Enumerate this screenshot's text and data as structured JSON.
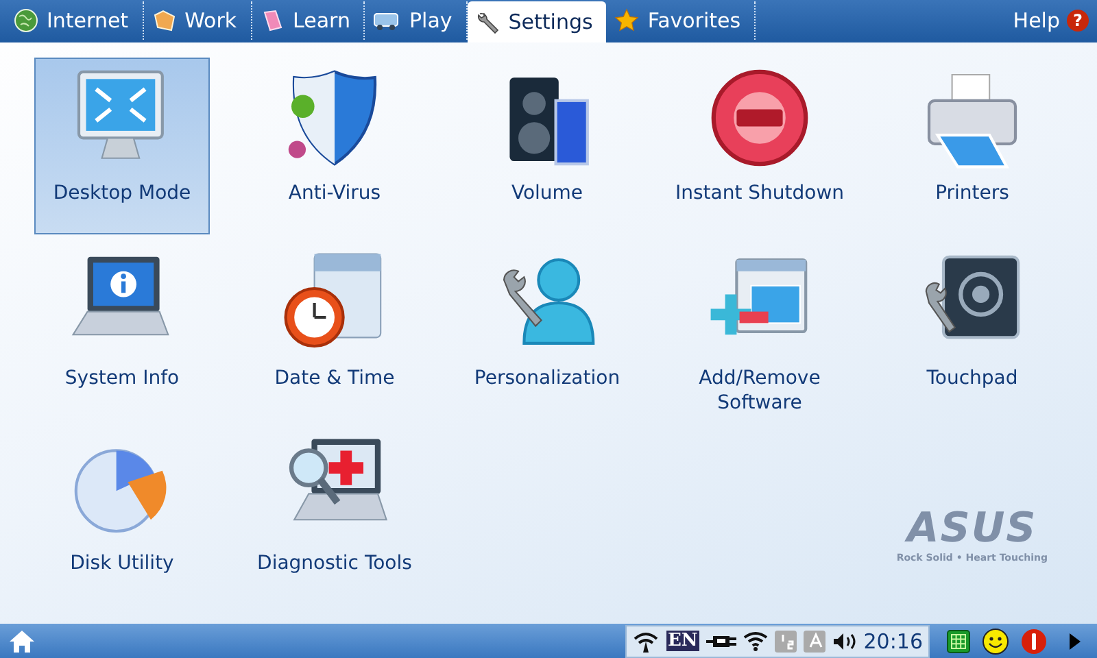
{
  "tabs": [
    {
      "label": "Internet",
      "selected": false
    },
    {
      "label": "Work",
      "selected": false
    },
    {
      "label": "Learn",
      "selected": false
    },
    {
      "label": "Play",
      "selected": false
    },
    {
      "label": "Settings",
      "selected": true
    },
    {
      "label": "Favorites",
      "selected": false
    }
  ],
  "help": {
    "label": "Help",
    "badge": "?"
  },
  "apps": [
    {
      "label": "Desktop Mode",
      "selected": true
    },
    {
      "label": "Anti-Virus",
      "selected": false
    },
    {
      "label": "Volume",
      "selected": false
    },
    {
      "label": "Instant Shutdown",
      "selected": false
    },
    {
      "label": "Printers",
      "selected": false
    },
    {
      "label": "System Info",
      "selected": false
    },
    {
      "label": "Date & Time",
      "selected": false
    },
    {
      "label": "Personalization",
      "selected": false
    },
    {
      "label": "Add/Remove Software",
      "selected": false
    },
    {
      "label": "Touchpad",
      "selected": false
    },
    {
      "label": "Disk Utility",
      "selected": false
    },
    {
      "label": "Diagnostic Tools",
      "selected": false
    }
  ],
  "logo": {
    "name": "ASUS",
    "tagline": "Rock Solid • Heart Touching"
  },
  "taskbar": {
    "language": "EN",
    "clock": "20:16"
  }
}
